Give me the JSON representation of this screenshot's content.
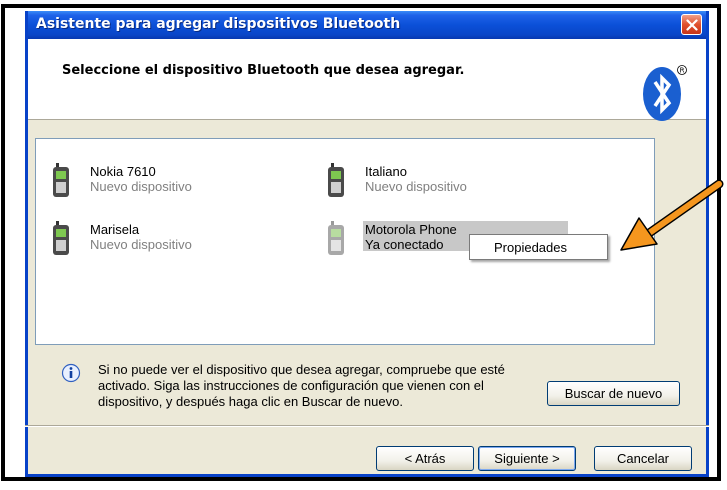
{
  "window": {
    "title": "Asistente para agregar dispositivos Bluetooth"
  },
  "header": {
    "instruction": "Seleccione el dispositivo Bluetooth que desea agregar."
  },
  "devices": [
    {
      "name": "Nokia 7610",
      "status": "Nuevo dispositivo",
      "icon": "phone-icon"
    },
    {
      "name": "Italiano",
      "status": "Nuevo dispositivo",
      "icon": "phone-icon"
    },
    {
      "name": "Marisela",
      "status": "Nuevo dispositivo",
      "icon": "phone-icon"
    },
    {
      "name": "Motorola Phone",
      "status": "Ya conectado",
      "icon": "phone-icon",
      "selected": true
    }
  ],
  "context_menu": {
    "items": [
      "Propiedades"
    ]
  },
  "info": {
    "text": "Si no puede ver el dispositivo que desea agregar, compruebe que esté activado. Siga las instrucciones de configuración que vienen con el dispositivo, y después haga clic en Buscar de nuevo."
  },
  "buttons": {
    "rescan": "Buscar de nuevo",
    "back": "< Atrás",
    "next": "Siguiente >",
    "cancel": "Cancelar"
  },
  "colors": {
    "titlebar": "#0b50d8",
    "arrow": "#f5961e",
    "bluetooth_logo": "#1a5fd0"
  }
}
